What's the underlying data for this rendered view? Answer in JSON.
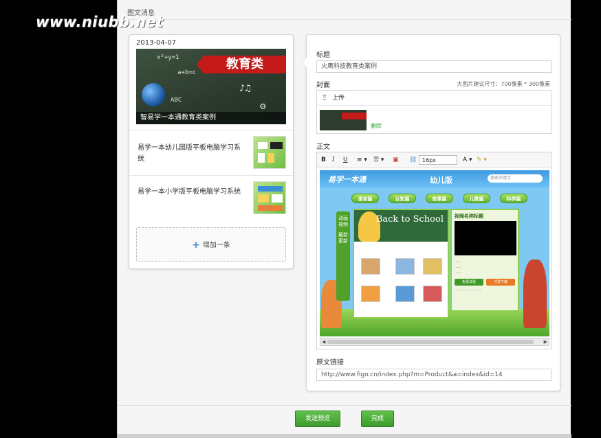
{
  "watermark": "www.niubb.net",
  "frame": {
    "title": "图文消息"
  },
  "left_list": {
    "date": "2013-04-07",
    "cover": {
      "ribbon_text": "教育类",
      "caption": "智易学一本通教育类案例"
    },
    "items": [
      {
        "title": "易学一本幼儿园版平板电脑学习系统"
      },
      {
        "title": "易学一本小学版平板电脑学习系统"
      }
    ],
    "add_label": "增加一条"
  },
  "form": {
    "title_label": "标题",
    "title_value": "火鹰科技教育类案例",
    "cover_label": "封面",
    "cover_hint": "大图片建议尺寸：700像素 * 300像素",
    "upload_label": "上传",
    "delete_label": "删除",
    "body_label": "正文",
    "toolbar": {
      "bold": "B",
      "italic": "I",
      "underline": "U",
      "ordered_list": "≡ ▾",
      "unordered_list": "☰ ▾",
      "font_size": "16px",
      "font_color": "A ▾",
      "bg_color": "✎ ▾"
    },
    "embedded_site": {
      "version": "幼儿版",
      "search_placeholder": "搜索关键字",
      "nav": [
        "语言篇",
        "认知篇",
        "故事篇",
        "儿歌篇",
        "科学篇"
      ],
      "video_title": "视频名称标题",
      "banner_text": "Back to School",
      "buttons": [
        "免费试看",
        "付费下载"
      ]
    },
    "source_link_label": "原文链接",
    "source_link_value": "http://www.figo.cn/index.php?m=Product&a=index&id=14"
  },
  "actions": {
    "preview_label": "发送预览",
    "done_label": "完成"
  },
  "colors": {
    "accent_green": "#3d9a2e",
    "ribbon_red": "#c41a1a",
    "link_blue": "#4a8ac9"
  }
}
